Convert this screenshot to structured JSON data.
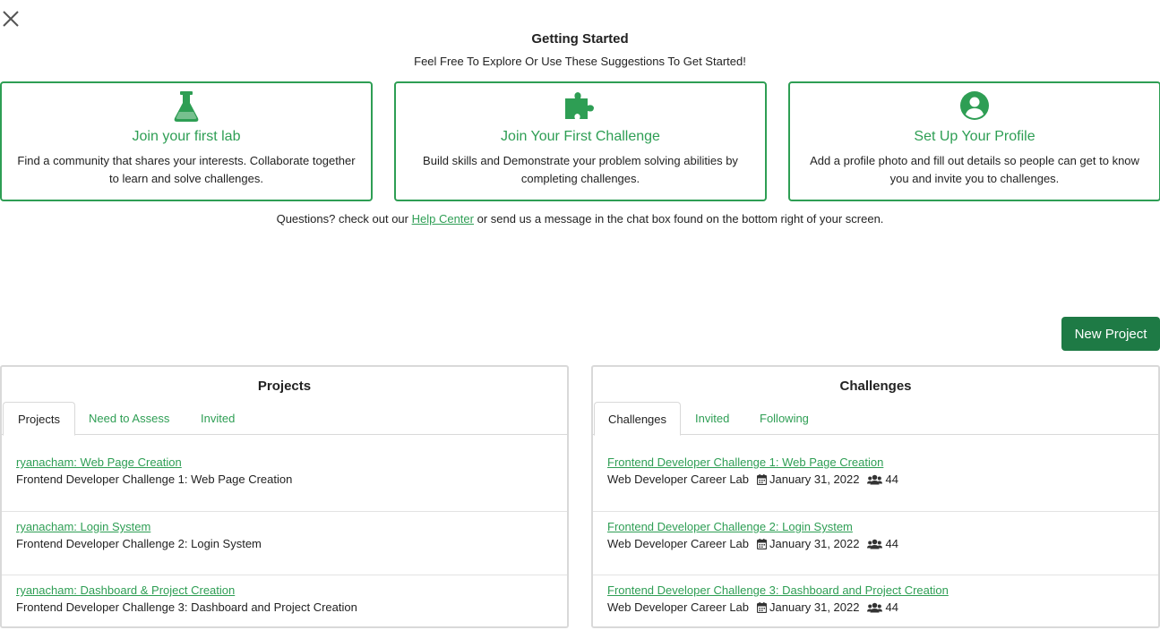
{
  "getting_started": {
    "title": "Getting Started",
    "subtitle": "Feel Free To Explore Or Use These Suggestions To Get Started!"
  },
  "cards": [
    {
      "icon": "flask-icon",
      "title": "Join your first lab",
      "desc": "Find a community that shares your interests. Collaborate together to learn and solve challenges."
    },
    {
      "icon": "puzzle-icon",
      "title": "Join Your First Challenge",
      "desc": "Build skills and Demonstrate your problem solving abilities by completing challenges."
    },
    {
      "icon": "user-circle-icon",
      "title": "Set Up Your Profile",
      "desc": "Add a profile photo and fill out details so people can get to know you and invite you to challenges."
    }
  ],
  "help": {
    "before": "Questions? check out our ",
    "link": "Help Center",
    "after": " or send us a message in the chat box found on the bottom right of your screen."
  },
  "new_project_label": "New Project",
  "projects": {
    "title": "Projects",
    "tabs": [
      "Projects",
      "Need to Assess",
      "Invited"
    ],
    "items": [
      {
        "link": "ryanacham: Web Page Creation",
        "sub": "Frontend Developer Challenge 1: Web Page Creation"
      },
      {
        "link": "ryanacham: Login System",
        "sub": "Frontend Developer Challenge 2: Login System"
      },
      {
        "link": "ryanacham: Dashboard & Project Creation",
        "sub": "Frontend Developer Challenge 3: Dashboard and Project Creation"
      }
    ]
  },
  "challenges": {
    "title": "Challenges",
    "tabs": [
      "Challenges",
      "Invited",
      "Following"
    ],
    "items": [
      {
        "link": "Frontend Developer Challenge 1: Web Page Creation",
        "lab": "Web Developer Career Lab",
        "date": "January 31, 2022",
        "count": "44"
      },
      {
        "link": "Frontend Developer Challenge 2: Login System",
        "lab": "Web Developer Career Lab",
        "date": "January 31, 2022",
        "count": "44"
      },
      {
        "link": "Frontend Developer Challenge 3: Dashboard and Project Creation",
        "lab": "Web Developer Career Lab",
        "date": "January 31, 2022",
        "count": "44"
      }
    ]
  },
  "colors": {
    "accent": "#2e9e54",
    "button": "#1e7a45",
    "border": "#d9d9d9"
  }
}
